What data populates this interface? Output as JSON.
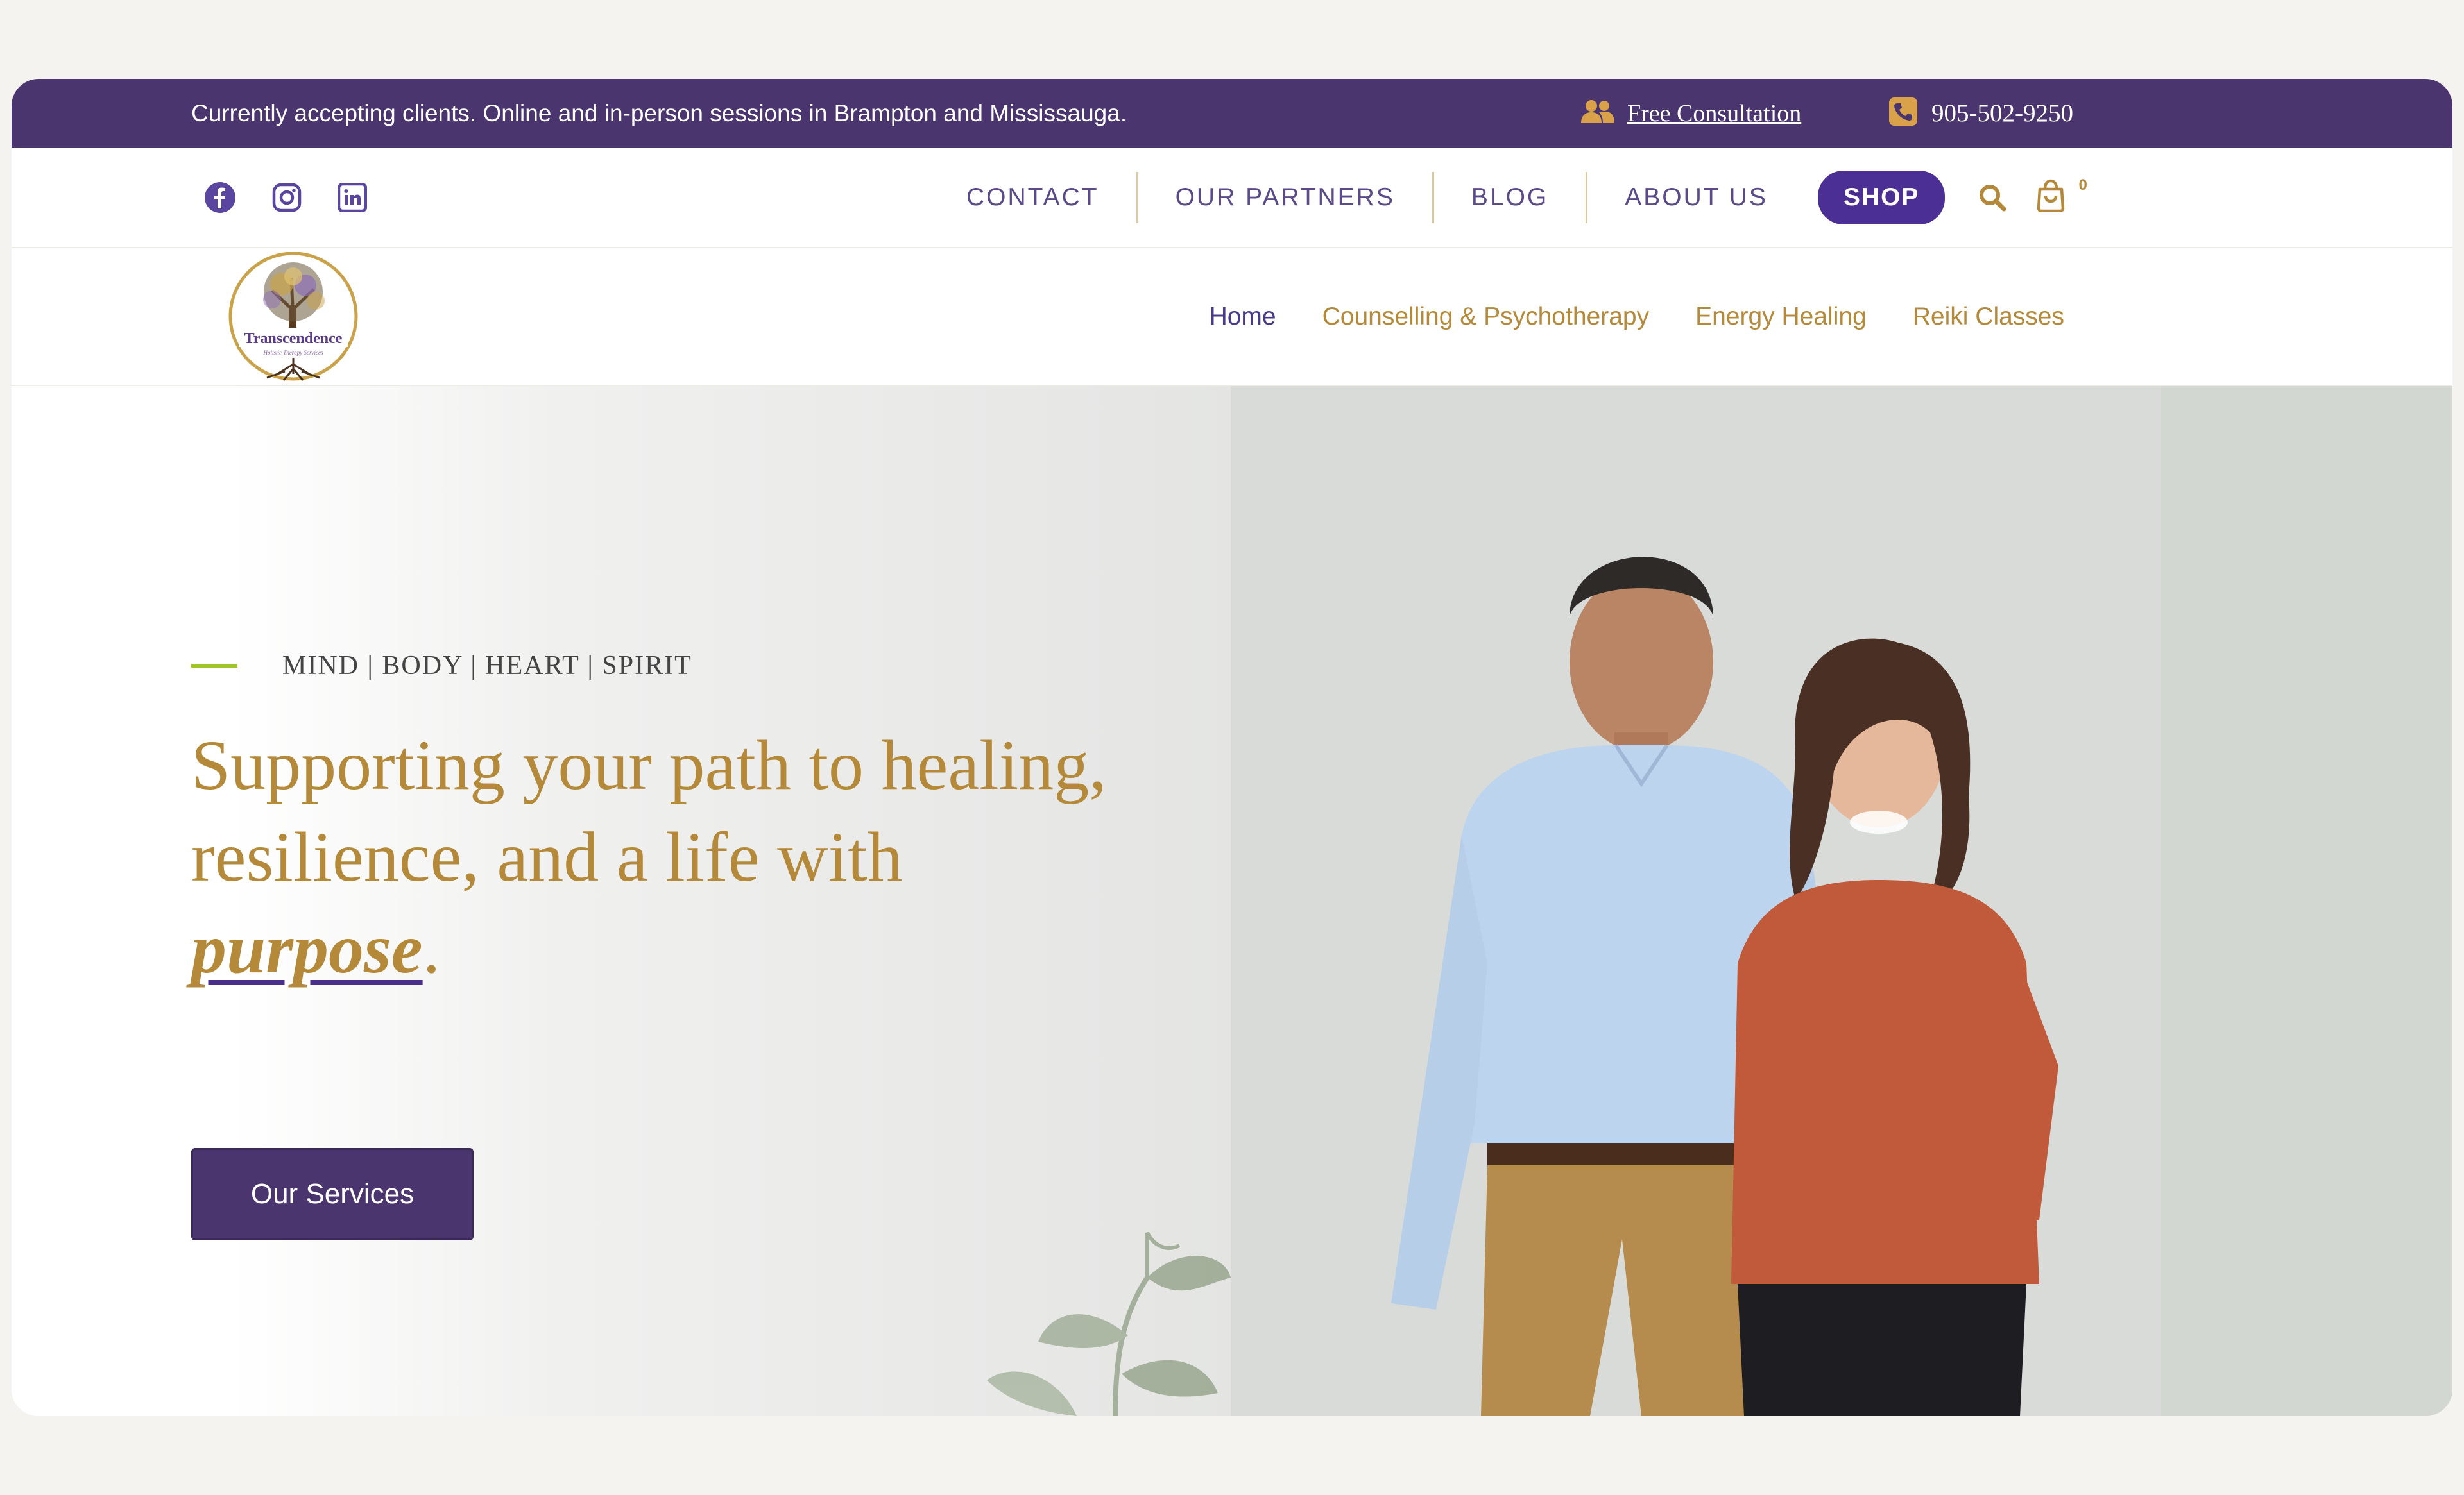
{
  "topbar": {
    "message": "Currently accepting clients. Online and in-person sessions in Brampton and Mississauga.",
    "consultation": "Free Consultation",
    "phone": "905-502-9250"
  },
  "social": [
    "facebook-icon",
    "instagram-icon",
    "linkedin-icon"
  ],
  "secondary_nav": {
    "items": [
      "CONTACT",
      "OUR PARTNERS",
      "BLOG",
      "ABOUT US"
    ],
    "shop": "SHOP",
    "cart_count": "0"
  },
  "logo": {
    "name": "Transcendence",
    "tagline": "Holistic Therapy Services"
  },
  "main_nav": {
    "items": [
      "Home",
      "Counselling & Psychotherapy",
      "Energy Healing",
      "Reiki Classes"
    ],
    "active": "Home"
  },
  "hero": {
    "eyebrow": "MIND | BODY | HEART | SPIRIT",
    "headline_start": "Supporting your path to healing, resilience, and a life with ",
    "headline_emphasis": "purpose",
    "headline_end": ".",
    "cta": "Our Services"
  },
  "colors": {
    "brand_purple": "#4a356e",
    "accent_gold": "#b48a3a",
    "shop_purple": "#4b2f95",
    "green_line": "#9fc52a"
  }
}
